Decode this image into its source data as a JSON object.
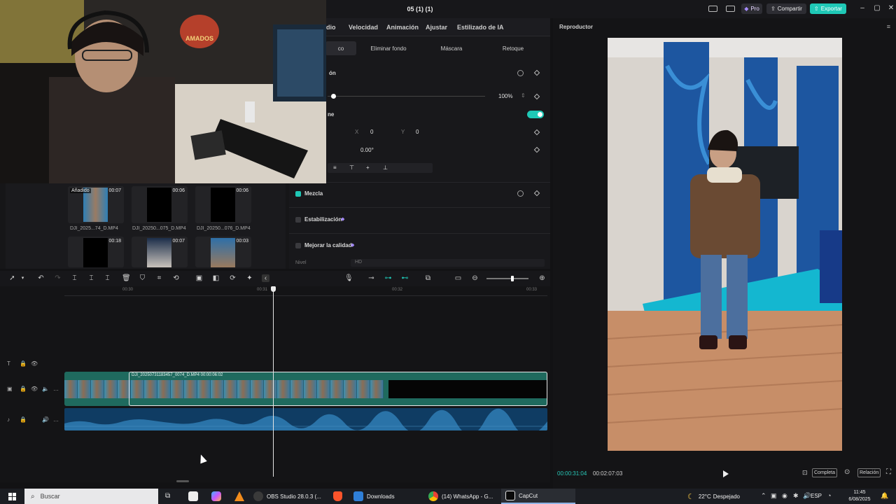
{
  "titlebar": {
    "doc_title": "05 (1) (1)",
    "pro_label": "Pro",
    "share_label": "Compartir",
    "export_label": "Exportar",
    "accent_color": "#1fc8b6"
  },
  "properties": {
    "tabs": [
      "dio",
      "Velocidad",
      "Animación",
      "Ajustar",
      "Estilizado de IA"
    ],
    "sub_tabs": [
      "co",
      "Eliminar fondo",
      "Máscara",
      "Retoque"
    ],
    "section_fragment": "ón",
    "scale_value": "100%",
    "blend_fragment": "ne",
    "pos_x_label": "X",
    "pos_x": "0",
    "pos_y_label": "Y",
    "pos_y": "0",
    "rotation": "0.00°",
    "mix_label": "Mezcla",
    "stabilize_label": "Estabilización",
    "enhance_label": "Mejorar la calidad",
    "level_label": "Nivel",
    "level_value": "HD"
  },
  "media": {
    "items": [
      {
        "badge": "Añadido",
        "duration": "00:07",
        "name": "DJI_2025...74_D.MP4"
      },
      {
        "badge": "",
        "duration": "00:06",
        "name": "DJI_20250...075_D.MP4"
      },
      {
        "badge": "",
        "duration": "00:06",
        "name": "DJI_20250...076_D.MP4"
      },
      {
        "badge": "",
        "duration": "00:18",
        "name": ""
      },
      {
        "badge": "",
        "duration": "00:07",
        "name": ""
      },
      {
        "badge": "",
        "duration": "00:03",
        "name": ""
      }
    ]
  },
  "timeline": {
    "ruler": [
      "00:30",
      "00:31",
      "00:32",
      "00:33"
    ],
    "clip_label": "DJI_20250731183457_0074_D.MP4   00:00:06:02"
  },
  "player": {
    "title": "Reproductor",
    "current_time": "00:00:31:04",
    "total_time": "00:02:07:03",
    "full_label": "Completa",
    "ratio_label": "Relación"
  },
  "taskbar": {
    "search_placeholder": "Buscar",
    "apps": [
      {
        "label": "OBS Studio 28.0.3 (...",
        "color": "#3a3a3a"
      },
      {
        "label": "Downloads",
        "color": "#2f7fd8"
      },
      {
        "label": "(14) WhatsApp - G...",
        "color": "#2aa64d"
      },
      {
        "label": "CapCut",
        "color": "#0a0a0a"
      }
    ],
    "weather_temp": "22°C",
    "weather_desc": "Despejado",
    "lang": "ESP",
    "time": "11:45",
    "date": "6/08/2025"
  }
}
